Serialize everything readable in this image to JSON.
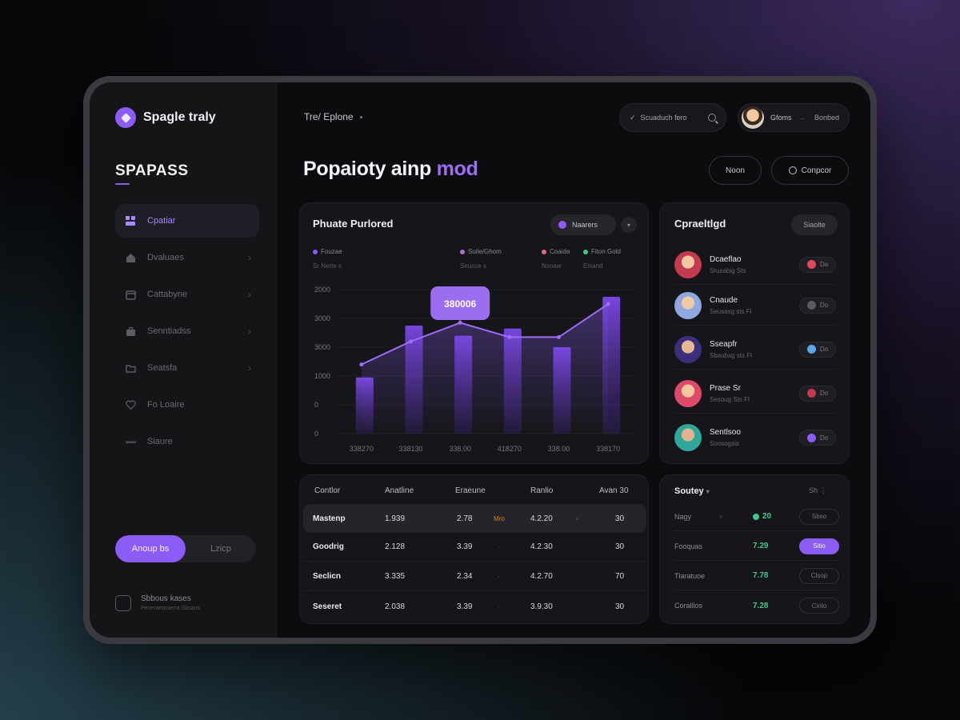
{
  "sidebar": {
    "brand": "Spagle traly",
    "section_title": "SPAPASS",
    "items": [
      {
        "label": "Cpatiar",
        "icon": "grid-icon",
        "active": true
      },
      {
        "label": "Dvaluaes",
        "icon": "home-icon",
        "active": false
      },
      {
        "label": "Cattabyne",
        "icon": "calendar-icon",
        "active": false
      },
      {
        "label": "Senntiadss",
        "icon": "briefcase-icon",
        "active": false
      },
      {
        "label": "Seatsfa",
        "icon": "folder-icon",
        "active": false
      },
      {
        "label": "Fo Loaire",
        "icon": "heart-icon",
        "active": false
      },
      {
        "label": "Siaure",
        "icon": "minus-icon",
        "active": false
      }
    ],
    "toggle": {
      "on_label": "Anoup bs",
      "off_label": "Lzicp"
    },
    "footer": {
      "title": "Sbbous kases",
      "subtitle": "Penerampuerra Sbsans"
    }
  },
  "header": {
    "breadcrumb": "Tre/ Eplone",
    "search_text": "Scuaduch fero",
    "user_name": "Gfoms",
    "user_role": "Bonbed"
  },
  "page": {
    "title_main": "Popaioty ainp",
    "title_accent": "mod",
    "btn_primary": "Noon",
    "btn_secondary": "Conpcor"
  },
  "chart_card": {
    "title": "Phuate Purlored",
    "pill_label": "Naarers",
    "legend": [
      {
        "label": "Fouzae",
        "sub": "Sr Nerte s",
        "color": "#8b5cf6"
      },
      {
        "label": "Suile/Ghom",
        "sub": "Sirucce s",
        "color": "#b26bd6"
      },
      {
        "label": "Coaida",
        "sub": "Nsoaw",
        "color": "#e06a7a"
      },
      {
        "label": "Fiton Gold",
        "sub": "Eisand",
        "color": "#3ec98a"
      }
    ]
  },
  "chart_data": {
    "type": "bar",
    "categories": [
      "338270",
      "338130",
      "338.00",
      "418270",
      "338.00",
      "338170"
    ],
    "ytick_labels": [
      "2000",
      "3000",
      "3000",
      "1000",
      "0",
      "0"
    ],
    "callout": "380006",
    "bars_level": [
      0.39,
      0.75,
      0.68,
      0.73,
      0.6,
      0.95
    ],
    "line_level": [
      0.48,
      0.64,
      0.77,
      0.67,
      0.67,
      0.9
    ],
    "colors": {
      "bar": "#6b3fd6",
      "line": "#9f6cf5",
      "callout": "#9d6df0"
    }
  },
  "list_card": {
    "title": "Cpraeltlgd",
    "button": "Siaolte",
    "people": [
      {
        "name": "Dcaeflao",
        "sub": "Srusabig Sts",
        "tag": "Da",
        "tag_color": "#e0485a",
        "avatar": "#c43b4f"
      },
      {
        "name": "Cnaude",
        "sub": "Seusasg sts Fl",
        "tag": "Do",
        "tag_color": "#5b5a66",
        "avatar": "#8fa8e0"
      },
      {
        "name": "Sseapfr",
        "sub": "Sbaubsg sts  Fl",
        "tag": "Do",
        "tag_color": "#5aa8e8",
        "avatar": "#3a2f7a"
      },
      {
        "name": "Prase Sr",
        "sub": "Sesoug Sts  Fl",
        "tag": "Do",
        "tag_color": "#c43b4f",
        "avatar": "#e04a6a"
      },
      {
        "name": "Sentlsoo",
        "sub": "Soosogsis",
        "tag": "Do",
        "tag_color": "#8b5cf6",
        "avatar": "#2fa79a"
      }
    ]
  },
  "table_card": {
    "headers": [
      "Contlor",
      "Anatline",
      "Eraeune",
      "Ranlio",
      "Avan 30"
    ],
    "rows": [
      {
        "name": "Mastenp",
        "c1": "1.939",
        "c2": "2.78",
        "tag": "Mro",
        "c3": "4.2.20",
        "mark": "▪",
        "c4": "30"
      },
      {
        "name": "Goodrig",
        "c1": "2.128",
        "c2": "3.39",
        "tag": "",
        "c3": "4.2.30",
        "mark": "·",
        "c4": "30"
      },
      {
        "name": "Seclicn",
        "c1": "3.335",
        "c2": "2.34",
        "tag": "",
        "c3": "4.2.70",
        "mark": "·",
        "c4": "70"
      },
      {
        "name": "Seseret",
        "c1": "2.038",
        "c2": "3.39",
        "tag": "",
        "c3": "3.9.30",
        "mark": "·",
        "c4": "30"
      }
    ]
  },
  "stat_card": {
    "title": "Soutey",
    "opts": "Sh  ⋮",
    "rows": [
      {
        "label": "Nagy",
        "value": "20",
        "button": "Sbso",
        "on": false
      },
      {
        "label": "Fooquas",
        "value": "7.29",
        "button": "Sitio",
        "on": true
      },
      {
        "label": "Tlaratuoe",
        "value": "7.78",
        "button": "Clsop",
        "on": false
      },
      {
        "label": "Coralilos",
        "value": "7.28",
        "button": "Cinto",
        "on": false
      }
    ]
  }
}
